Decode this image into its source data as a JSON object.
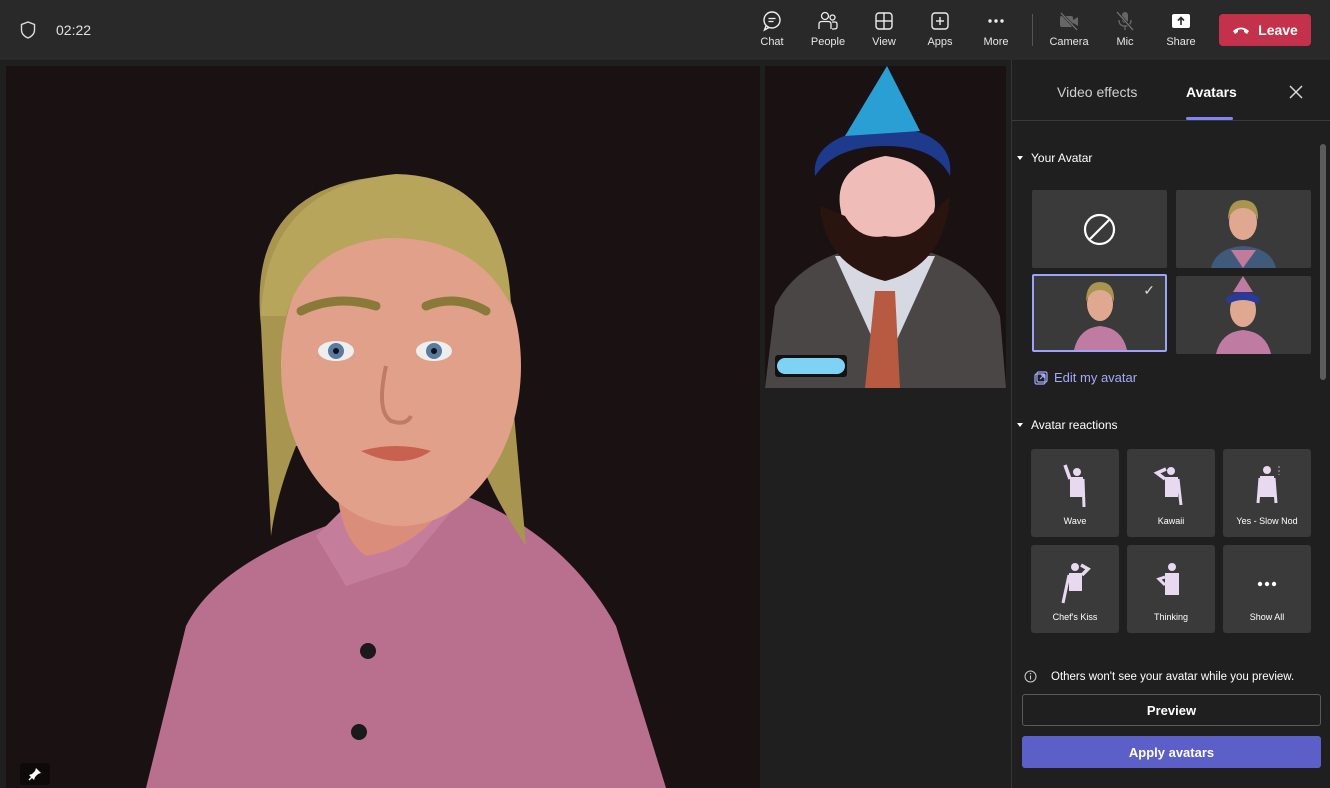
{
  "topbar": {
    "timer": "02:22",
    "buttons": [
      {
        "id": "chat",
        "label": "Chat",
        "icon": "chat-icon"
      },
      {
        "id": "people",
        "label": "People",
        "icon": "people-icon"
      },
      {
        "id": "view",
        "label": "View",
        "icon": "grid-icon"
      },
      {
        "id": "apps",
        "label": "Apps",
        "icon": "plus-square-icon"
      },
      {
        "id": "more",
        "label": "More",
        "icon": "ellipsis-icon"
      },
      {
        "id": "camera",
        "label": "Camera",
        "icon": "camera-off-icon"
      },
      {
        "id": "mic",
        "label": "Mic",
        "icon": "mic-off-icon"
      },
      {
        "id": "share",
        "label": "Share",
        "icon": "share-icon"
      }
    ],
    "leave_label": "Leave",
    "leave_color": "#c4314b"
  },
  "panel": {
    "tabs": [
      {
        "label": "Video effects",
        "active": false
      },
      {
        "label": "Avatars",
        "active": true
      }
    ],
    "accent": "#7f85f5",
    "your_avatar": {
      "heading": "Your Avatar",
      "tiles": [
        {
          "name": "none",
          "selected": false
        },
        {
          "name": "avatar-patterned-shirt",
          "selected": false
        },
        {
          "name": "avatar-pink-shirt",
          "selected": true
        },
        {
          "name": "avatar-party-hat",
          "selected": false
        }
      ],
      "edit_label": "Edit my avatar"
    },
    "reactions": {
      "heading": "Avatar reactions",
      "items": [
        {
          "label": "Wave"
        },
        {
          "label": "Kawaii"
        },
        {
          "label": "Yes - Slow Nod"
        },
        {
          "label": "Chef's Kiss"
        },
        {
          "label": "Thinking"
        },
        {
          "label": "Show All"
        }
      ]
    },
    "info_text": "Others won't see your avatar while you preview.",
    "preview_label": "Preview",
    "apply_label": "Apply avatars",
    "apply_color": "#5b5fc7"
  }
}
